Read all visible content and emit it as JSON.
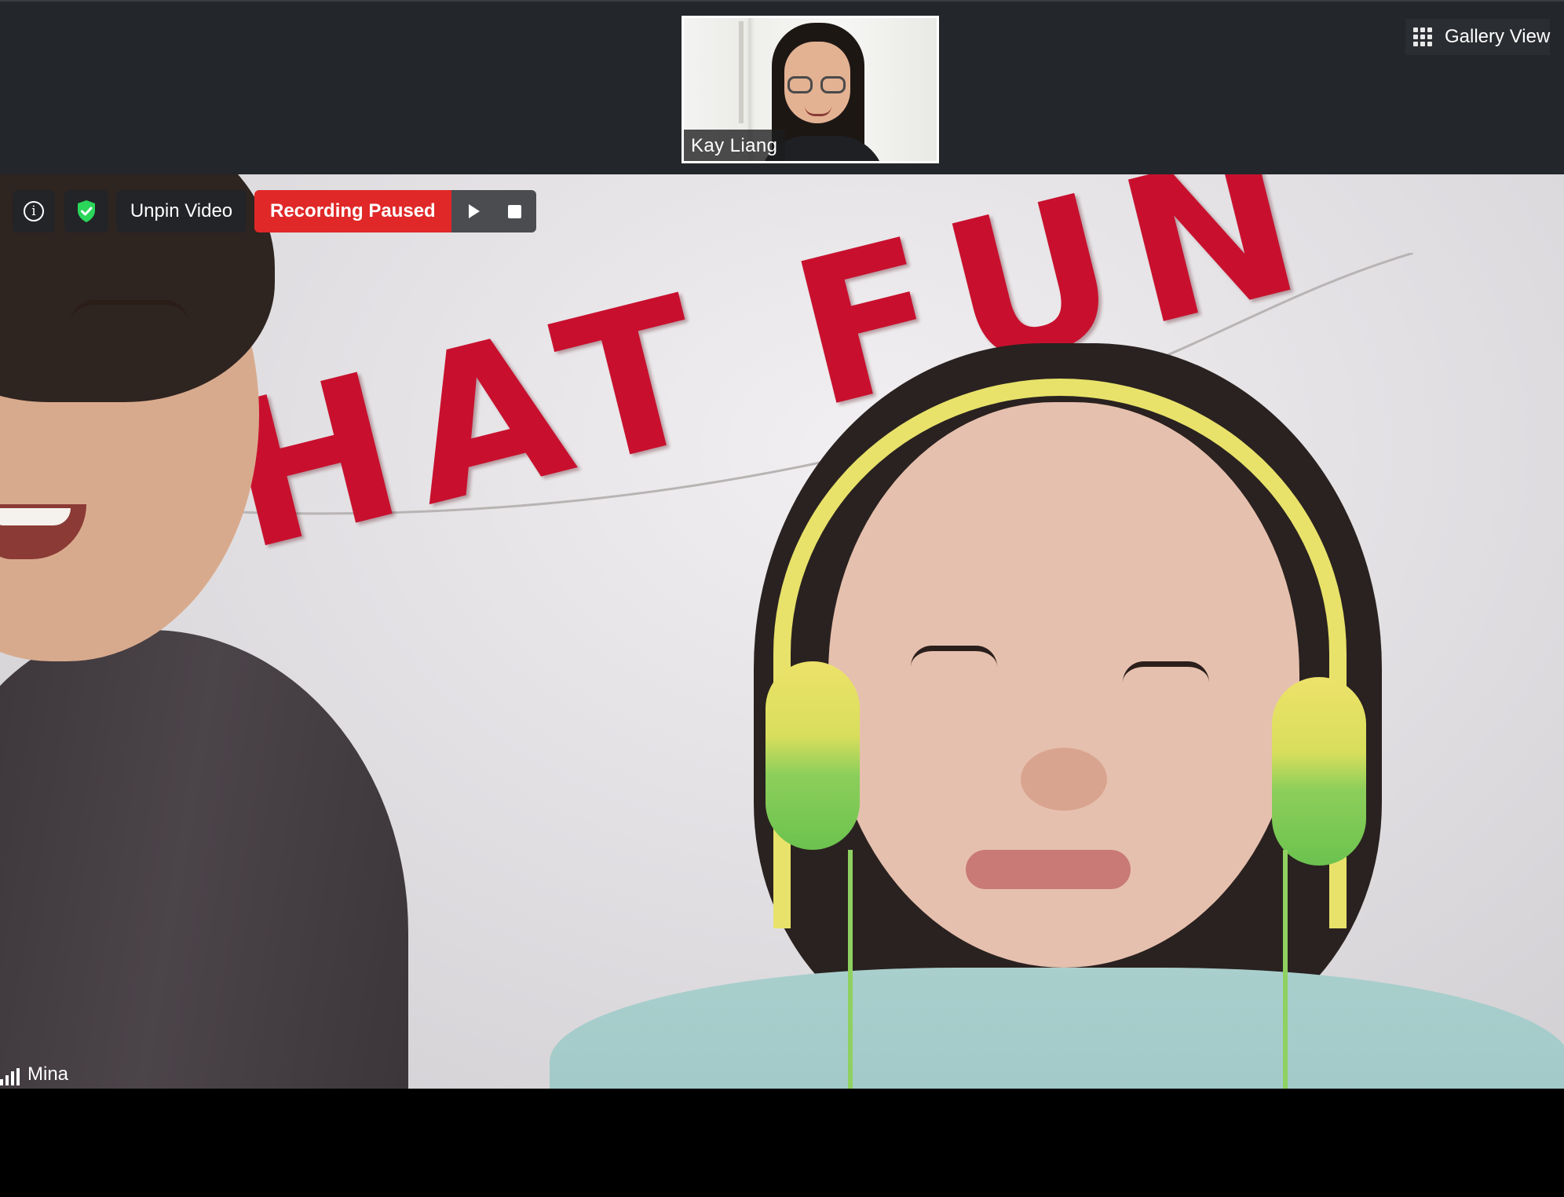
{
  "top_strip": {
    "thumbnail": {
      "participant_name": "Kay Liang"
    },
    "gallery_view_label": "Gallery View",
    "gallery_view_icon": "grid-icon"
  },
  "main_video": {
    "participant_name": "Mina",
    "banner_text": "HAT FUN"
  },
  "toolbar": {
    "info_icon": "info-icon",
    "security_icon": "shield-check-icon",
    "security_color": "#2bd65a",
    "unpin_label": "Unpin Video",
    "recording_label": "Recording Paused",
    "recording_color": "#e02828",
    "resume_icon": "play-icon",
    "stop_icon": "stop-icon"
  }
}
